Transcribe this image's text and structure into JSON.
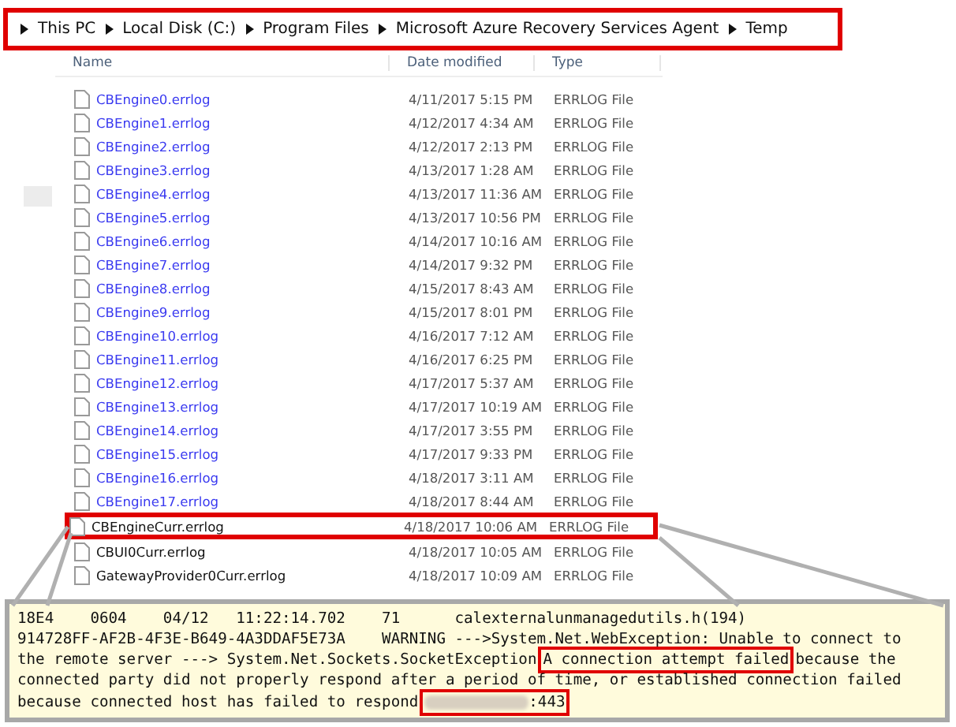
{
  "breadcrumb": {
    "highlighted": true,
    "items": [
      "This PC",
      "Local Disk (C:)",
      "Program Files",
      "Microsoft Azure Recovery Services Agent",
      "Temp"
    ]
  },
  "columns": [
    "Name",
    "Date modified",
    "Type"
  ],
  "files": [
    {
      "name": "CBEngine0.errlog",
      "date": "4/11/2017 5:15 PM",
      "type": "ERRLOG File",
      "visited": true,
      "highlighted": false
    },
    {
      "name": "CBEngine1.errlog",
      "date": "4/12/2017 4:34 AM",
      "type": "ERRLOG File",
      "visited": true,
      "highlighted": false
    },
    {
      "name": "CBEngine2.errlog",
      "date": "4/12/2017 2:13 PM",
      "type": "ERRLOG File",
      "visited": true,
      "highlighted": false
    },
    {
      "name": "CBEngine3.errlog",
      "date": "4/13/2017 1:28 AM",
      "type": "ERRLOG File",
      "visited": true,
      "highlighted": false
    },
    {
      "name": "CBEngine4.errlog",
      "date": "4/13/2017 11:36 AM",
      "type": "ERRLOG File",
      "visited": true,
      "highlighted": false
    },
    {
      "name": "CBEngine5.errlog",
      "date": "4/13/2017 10:56 PM",
      "type": "ERRLOG File",
      "visited": true,
      "highlighted": false
    },
    {
      "name": "CBEngine6.errlog",
      "date": "4/14/2017 10:16 AM",
      "type": "ERRLOG File",
      "visited": true,
      "highlighted": false
    },
    {
      "name": "CBEngine7.errlog",
      "date": "4/14/2017 9:32 PM",
      "type": "ERRLOG File",
      "visited": true,
      "highlighted": false
    },
    {
      "name": "CBEngine8.errlog",
      "date": "4/15/2017 8:43 AM",
      "type": "ERRLOG File",
      "visited": true,
      "highlighted": false
    },
    {
      "name": "CBEngine9.errlog",
      "date": "4/15/2017 8:01 PM",
      "type": "ERRLOG File",
      "visited": true,
      "highlighted": false
    },
    {
      "name": "CBEngine10.errlog",
      "date": "4/16/2017 7:12 AM",
      "type": "ERRLOG File",
      "visited": true,
      "highlighted": false
    },
    {
      "name": "CBEngine11.errlog",
      "date": "4/16/2017 6:25 PM",
      "type": "ERRLOG File",
      "visited": true,
      "highlighted": false
    },
    {
      "name": "CBEngine12.errlog",
      "date": "4/17/2017 5:37 AM",
      "type": "ERRLOG File",
      "visited": true,
      "highlighted": false
    },
    {
      "name": "CBEngine13.errlog",
      "date": "4/17/2017 10:19 AM",
      "type": "ERRLOG File",
      "visited": true,
      "highlighted": false
    },
    {
      "name": "CBEngine14.errlog",
      "date": "4/17/2017 3:55 PM",
      "type": "ERRLOG File",
      "visited": true,
      "highlighted": false
    },
    {
      "name": "CBEngine15.errlog",
      "date": "4/17/2017 9:33 PM",
      "type": "ERRLOG File",
      "visited": true,
      "highlighted": false
    },
    {
      "name": "CBEngine16.errlog",
      "date": "4/18/2017 3:11 AM",
      "type": "ERRLOG File",
      "visited": true,
      "highlighted": false
    },
    {
      "name": "CBEngine17.errlog",
      "date": "4/18/2017 8:44 AM",
      "type": "ERRLOG File",
      "visited": true,
      "highlighted": false
    },
    {
      "name": "CBEngineCurr.errlog",
      "date": "4/18/2017 10:06 AM",
      "type": "ERRLOG File",
      "visited": false,
      "highlighted": true
    },
    {
      "name": "CBUI0Curr.errlog",
      "date": "4/18/2017 10:05 AM",
      "type": "ERRLOG File",
      "visited": false,
      "highlighted": false
    },
    {
      "name": "GatewayProvider0Curr.errlog",
      "date": "4/18/2017 10:09 AM",
      "type": "ERRLOG File",
      "visited": false,
      "highlighted": false
    }
  ],
  "log_lines": [
    [
      {
        "kind": "text",
        "text": "18E4    0604    04/12   11:22:14.702    71      calexternalunmanagedutils.h(194)"
      }
    ],
    [
      {
        "kind": "text",
        "text": "914728FF-AF2B-4F3E-B649-4A3DDAF5E73A    WARNING --->System.Net.WebException: Unable to connect to"
      }
    ],
    [
      {
        "kind": "text",
        "text": "the remote server ---> System.Net.Sockets.SocketException"
      },
      {
        "kind": "highlight",
        "text": "A connection attempt failed"
      },
      {
        "kind": "text",
        "text": "because the"
      }
    ],
    [
      {
        "kind": "text",
        "text": "connected party did not properly respond after a period of time, or established connection failed"
      }
    ],
    [
      {
        "kind": "text",
        "text": "because connected host has failed to respond"
      },
      {
        "kind": "redacted",
        "text": ":443"
      }
    ]
  ]
}
